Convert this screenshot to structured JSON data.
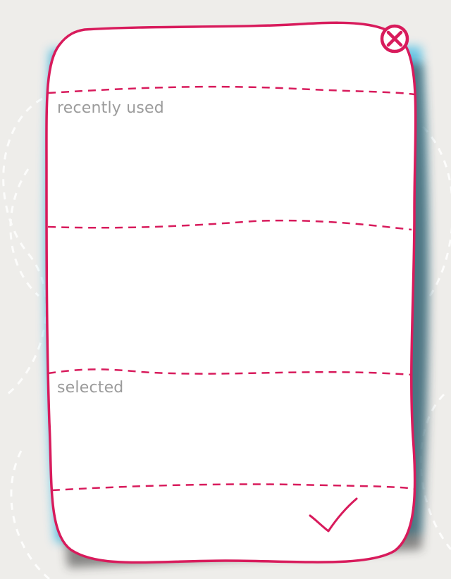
{
  "sections": {
    "recent_label": "recently used",
    "selected_label": "selected"
  },
  "icons": {
    "close": "close-circle-x-icon",
    "confirm": "checkmark-icon"
  },
  "colors": {
    "accent": "#d81b5c",
    "label": "#9b9b9b",
    "shadow_blue": "#5bc3e6",
    "background": "#eeedea"
  }
}
